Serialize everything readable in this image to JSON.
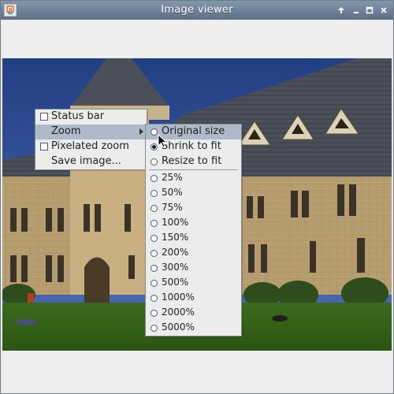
{
  "window": {
    "title": "Image viewer"
  },
  "titlebar": {
    "buttons": [
      {
        "name": "pin",
        "glyph": "↑"
      },
      {
        "name": "minimize",
        "glyph": "–"
      },
      {
        "name": "maximize",
        "glyph": "□"
      },
      {
        "name": "close",
        "glyph": "✕"
      }
    ]
  },
  "context_menu": {
    "items": [
      {
        "label": "Status bar",
        "type": "checkbox",
        "checked": false
      },
      {
        "label": "Zoom",
        "type": "submenu",
        "selected": true
      },
      {
        "label": "Pixelated zoom",
        "type": "checkbox",
        "checked": false
      },
      {
        "label": "Save image...",
        "type": "action"
      }
    ]
  },
  "zoom_menu": {
    "items": [
      {
        "label": "Original size",
        "checked": false,
        "selected": true
      },
      {
        "label": "Shrink to fit",
        "checked": true
      },
      {
        "label": "Resize to fit",
        "checked": false
      },
      {
        "label": "25%",
        "checked": false
      },
      {
        "label": "50%",
        "checked": false
      },
      {
        "label": "75%",
        "checked": false
      },
      {
        "label": "100%",
        "checked": false
      },
      {
        "label": "150%",
        "checked": false
      },
      {
        "label": "200%",
        "checked": false
      },
      {
        "label": "300%",
        "checked": false
      },
      {
        "label": "500%",
        "checked": false
      },
      {
        "label": "1000%",
        "checked": false
      },
      {
        "label": "2000%",
        "checked": false
      },
      {
        "label": "5000%",
        "checked": false
      }
    ]
  },
  "colors": {
    "titlebar": "#6a7d95",
    "menu_bg": "#ececec",
    "menu_highlight": "#aeb9c9"
  }
}
